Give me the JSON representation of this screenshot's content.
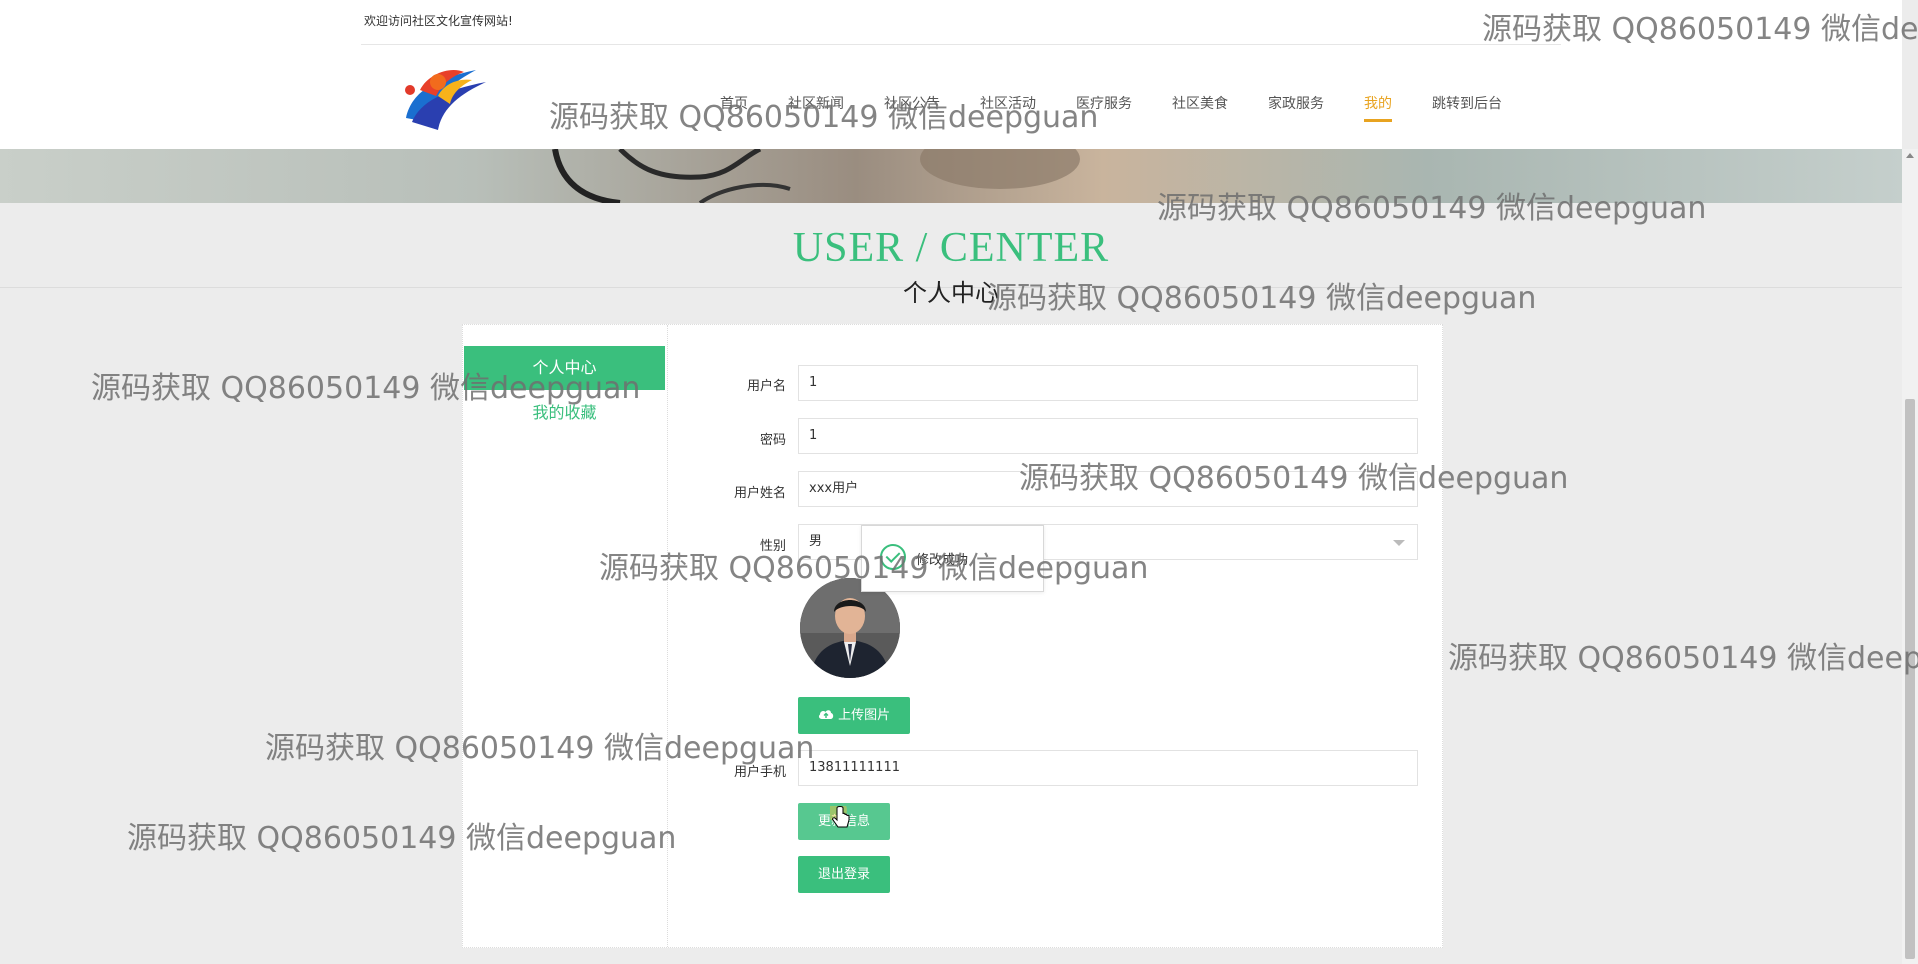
{
  "header": {
    "welcome": "欢迎访问社区文化宣传网站!",
    "nav": [
      "首页",
      "社区新闻",
      "社区公告",
      "社区活动",
      "医疗服务",
      "社区美食",
      "家政服务",
      "我的",
      "跳转到后台"
    ],
    "active_nav_index": 7
  },
  "page": {
    "title_en": "USER / CENTER",
    "title_cn": "个人中心"
  },
  "sidebar": {
    "active_label": "个人中心",
    "collect_label": "我的收藏"
  },
  "form": {
    "username_label": "用户名",
    "username_value": "1",
    "password_label": "密码",
    "password_value": "1",
    "realname_label": "用户姓名",
    "realname_value": "xxx用户",
    "gender_label": "性别",
    "gender_value": "男",
    "upload_label": "上传图片",
    "phone_label": "用户手机",
    "phone_value": "13811111111",
    "update_label": "更新信息",
    "logout_label": "退出登录"
  },
  "toast": {
    "text": "修改成功"
  },
  "watermark": "源码获取 QQ86050149 微信deepguan",
  "colors": {
    "accent": "#3abf7d",
    "active_nav": "#e8a320"
  }
}
